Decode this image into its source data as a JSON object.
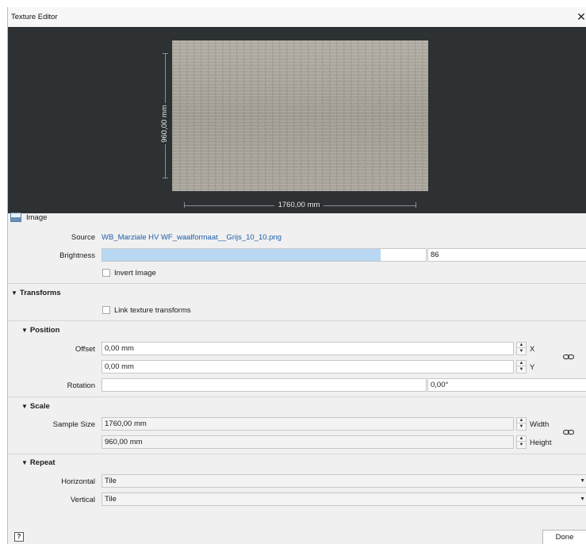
{
  "window": {
    "title": "Texture Editor",
    "close_glyph": "✕"
  },
  "preview": {
    "height_label": "960,00 mm",
    "width_label": "1760,00 mm"
  },
  "image_section": {
    "title": "Image",
    "source_label": "Source",
    "source_value": "WB_Marziale HV WF_waalformaat__Grijs_10_10.png",
    "brightness_label": "Brightness",
    "brightness_value": "86",
    "brightness_fraction": 0.86,
    "invert_label": "Invert Image",
    "invert_checked": false
  },
  "transforms": {
    "title": "Transforms",
    "link_label": "Link texture transforms",
    "link_checked": false
  },
  "position": {
    "title": "Position",
    "offset_label": "Offset",
    "offset_x": "0,00 mm",
    "offset_y": "0,00 mm",
    "x_label": "X",
    "y_label": "Y",
    "rotation_label": "Rotation",
    "rotation_value": "0,00°"
  },
  "scale": {
    "title": "Scale",
    "sample_size_label": "Sample Size",
    "width_value": "1760,00 mm",
    "height_value": "960,00 mm",
    "width_label": "Width",
    "height_label": "Height"
  },
  "repeat": {
    "title": "Repeat",
    "horizontal_label": "Horizontal",
    "horizontal_value": "Tile",
    "vertical_label": "Vertical",
    "vertical_value": "Tile"
  },
  "footer": {
    "help_glyph": "?",
    "done_label": "Done"
  },
  "icons": {
    "section_toggle": "triangle-down-icon",
    "link": "chain-link-icon",
    "image": "image-icon"
  },
  "colors": {
    "preview_bg": "#2d3134",
    "link": "#1d5fa8",
    "slider_fill": "#b8d7f2"
  }
}
